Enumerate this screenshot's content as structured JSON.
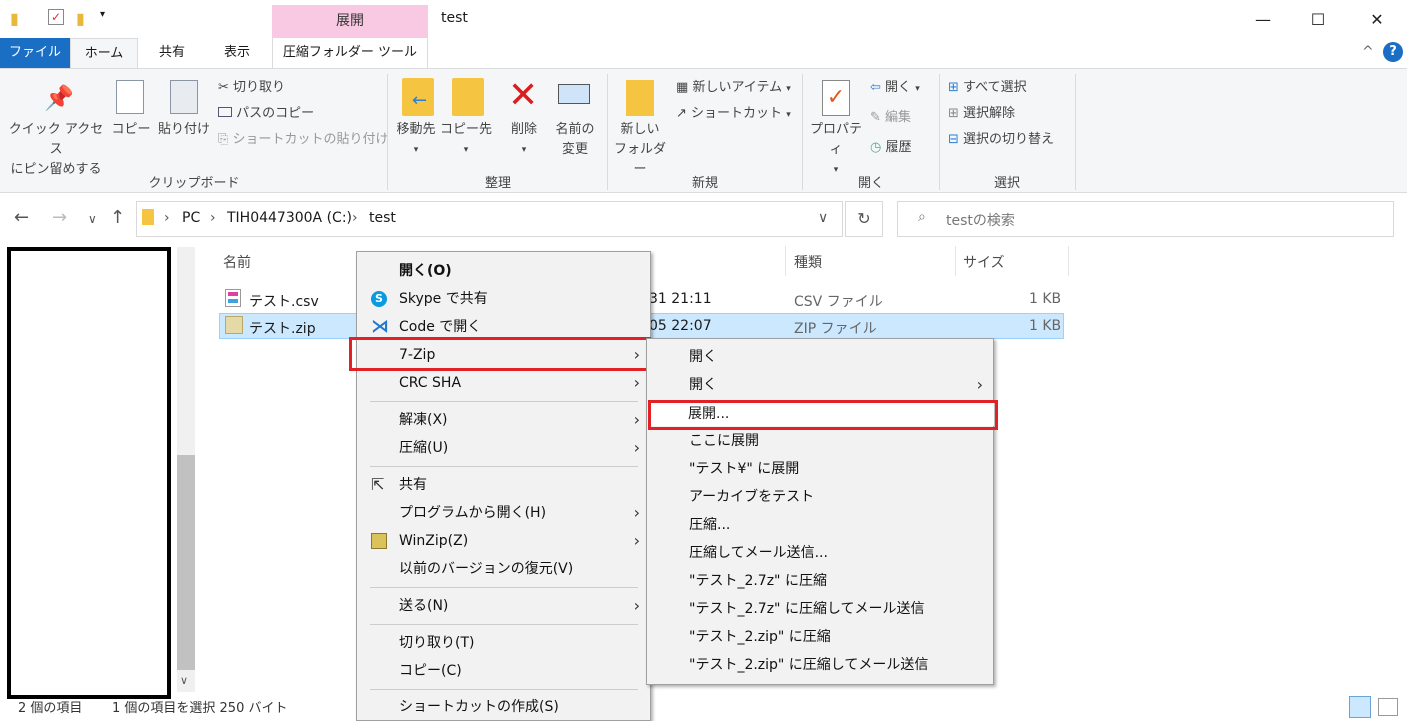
{
  "window": {
    "title": "test",
    "context_tab": "展開"
  },
  "tabs": [
    "ファイル",
    "ホーム",
    "共有",
    "表示",
    "圧縮フォルダー ツール"
  ],
  "ribbon": {
    "pin_line1": "クイック アクセス",
    "pin_line2": "にピン留めする",
    "copy": "コピー",
    "paste": "貼り付け",
    "cut": "切り取り",
    "copy_path": "パスのコピー",
    "paste_shortcut": "ショートカットの貼り付け",
    "group_clipboard": "クリップボード",
    "move_to": "移動先",
    "copy_to": "コピー先",
    "delete": "削除",
    "rename_line1": "名前の",
    "rename_line2": "変更",
    "group_organize": "整理",
    "new_folder_line1": "新しい",
    "new_folder_line2": "フォルダー",
    "new_item": "新しいアイテム",
    "shortcut": "ショートカット",
    "group_new": "新規",
    "properties": "プロパティ",
    "open": "開く",
    "edit": "編集",
    "history": "履歴",
    "group_open": "開く",
    "select_all": "すべて選択",
    "select_none": "選択解除",
    "invert_selection": "選択の切り替え",
    "group_select": "選択"
  },
  "address": {
    "crumbs": [
      "PC",
      "TIH0447300A (C:)",
      "test"
    ],
    "search_placeholder": "testの検索"
  },
  "columns": {
    "name": "名前",
    "type": "種類",
    "size": "サイズ"
  },
  "files": [
    {
      "name": "テスト.csv",
      "date": "31 21:11",
      "type": "CSV ファイル",
      "size": "1 KB"
    },
    {
      "name": "テスト.zip",
      "date": "05 22:07",
      "type": "ZIP ファイル",
      "size": "1 KB"
    }
  ],
  "context_menu": [
    {
      "label": "開く(O)",
      "bold": true
    },
    {
      "label": "Skype で共有"
    },
    {
      "label": "Code で開く"
    },
    {
      "label": "7-Zip",
      "submenu": true
    },
    {
      "label": "CRC SHA",
      "submenu": true
    },
    {
      "label": "解凍(X)",
      "submenu": true
    },
    {
      "label": "圧縮(U)",
      "submenu": true
    },
    {
      "label": "共有"
    },
    {
      "label": "プログラムから開く(H)",
      "submenu": true
    },
    {
      "label": "WinZip(Z)",
      "submenu": true
    },
    {
      "label": "以前のバージョンの復元(V)"
    },
    {
      "label": "送る(N)",
      "submenu": true
    },
    {
      "label": "切り取り(T)"
    },
    {
      "label": "コピー(C)"
    },
    {
      "label": "ショートカットの作成(S)"
    }
  ],
  "submenu_7zip": [
    "開く",
    "開く",
    "展開...",
    "ここに展開",
    "\"テスト¥\" に展開",
    "アーカイブをテスト",
    "圧縮...",
    "圧縮してメール送信...",
    "\"テスト_2.7z\" に圧縮",
    "\"テスト_2.7z\" に圧縮してメール送信",
    "\"テスト_2.zip\" に圧縮",
    "\"テスト_2.zip\" に圧縮してメール送信"
  ],
  "status": {
    "count": "2 個の項目",
    "selected": "1 個の項目を選択 250 バイト"
  },
  "colors": {
    "accent": "#1a6fc4",
    "highlight": "#e12126",
    "context_tab": "#f9c9e4"
  }
}
